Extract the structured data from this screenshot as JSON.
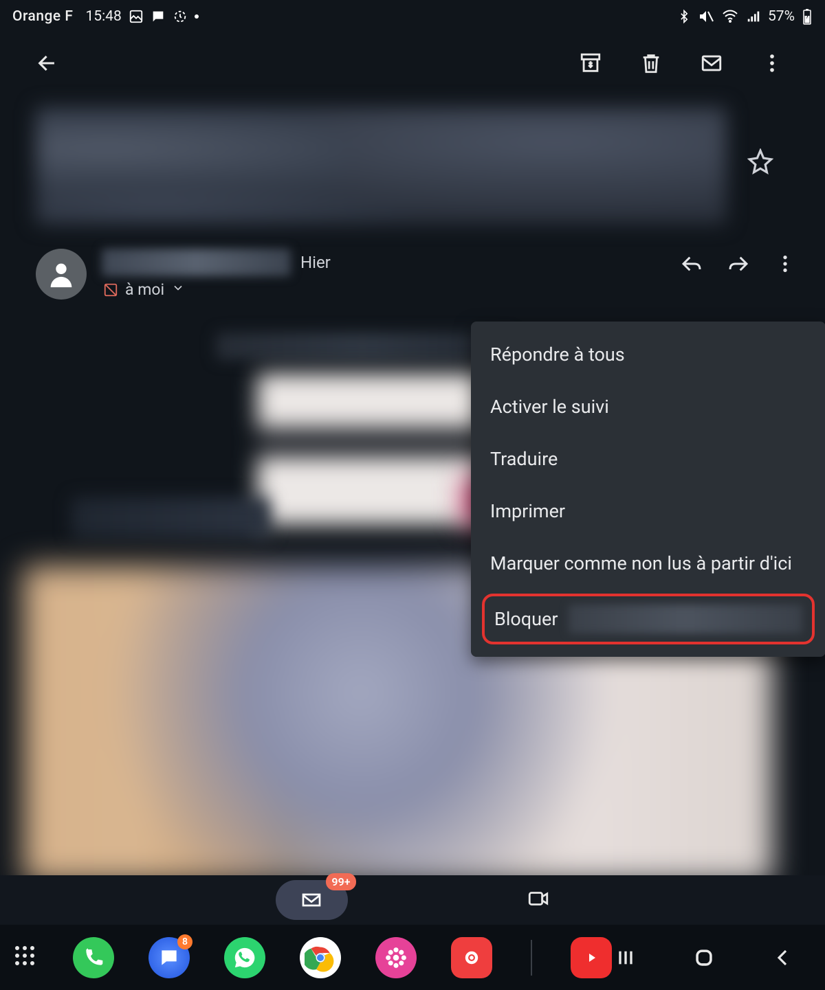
{
  "status": {
    "carrier": "Orange F",
    "time": "15:48",
    "battery_pct": "57%"
  },
  "message": {
    "timestamp": "Hier",
    "to_label": "à moi"
  },
  "context_menu": {
    "items": [
      "Répondre à tous",
      "Activer le suivi",
      "Traduire",
      "Imprimer",
      "Marquer comme non lus à partir d'ici"
    ],
    "block_label": "Bloquer"
  },
  "gmail_tabs": {
    "mail_badge": "99+"
  },
  "dock": {
    "messages_badge": "8"
  }
}
